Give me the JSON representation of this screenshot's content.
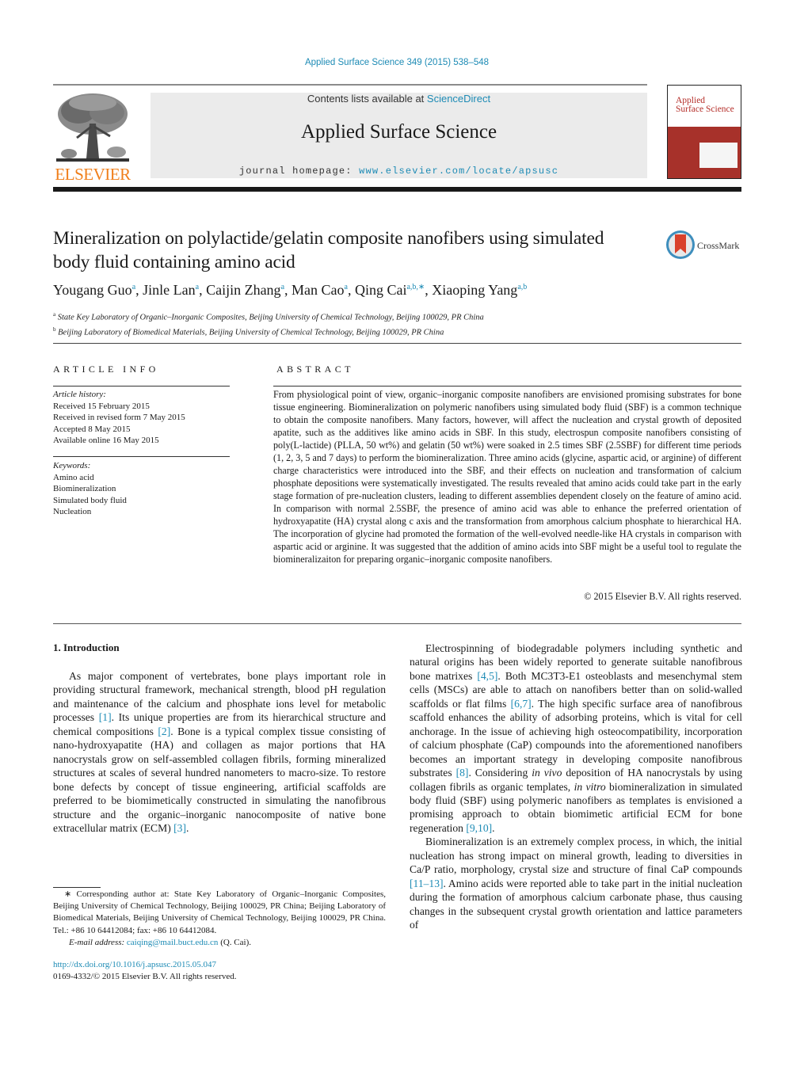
{
  "running_head": "Applied Surface Science 349 (2015) 538–548",
  "masthead": {
    "publisher_name": "ELSEVIER",
    "contents_prefix": "Contents lists available at ",
    "contents_link": "ScienceDirect",
    "journal_title": "Applied Surface Science",
    "homepage_prefix": "journal homepage: ",
    "homepage_link": "www.elsevier.com/locate/apsusc",
    "cover_title_line1": "Applied",
    "cover_title_line2": "Surface Science",
    "colors": {
      "link": "#1d8bb5",
      "elsevier_orange": "#f07f1b",
      "cover_red": "#a7312a",
      "box_gray": "#ebebeb"
    }
  },
  "article": {
    "title": "Mineralization on polylactide/gelatin composite nanofibers using simulated body fluid containing amino acid",
    "crossmark_label": "CrossMark",
    "authors": [
      {
        "name": "Yougang Guo",
        "aff": "a"
      },
      {
        "name": "Jinle Lan",
        "aff": "a"
      },
      {
        "name": "Caijin Zhang",
        "aff": "a"
      },
      {
        "name": "Man Cao",
        "aff": "a"
      },
      {
        "name": "Qing Cai",
        "aff": "a,b,∗"
      },
      {
        "name": "Xiaoping Yang",
        "aff": "a,b"
      }
    ],
    "affiliations": [
      {
        "key": "a",
        "text": "State Key Laboratory of Organic–Inorganic Composites, Beijing University of Chemical Technology, Beijing 100029, PR China"
      },
      {
        "key": "b",
        "text": "Beijing Laboratory of Biomedical Materials, Beijing University of Chemical Technology, Beijing 100029, PR China"
      }
    ]
  },
  "article_info": {
    "heading": "ARTICLE INFO",
    "history_label": "Article history:",
    "history": [
      "Received 15 February 2015",
      "Received in revised form 7 May 2015",
      "Accepted 8 May 2015",
      "Available online 16 May 2015"
    ],
    "keywords_label": "Keywords:",
    "keywords": [
      "Amino acid",
      "Biomineralization",
      "Simulated body fluid",
      "Nucleation"
    ]
  },
  "abstract": {
    "heading": "ABSTRACT",
    "text": "From physiological point of view, organic–inorganic composite nanofibers are envisioned promising substrates for bone tissue engineering. Biomineralization on polymeric nanofibers using simulated body fluid (SBF) is a common technique to obtain the composite nanofibers. Many factors, however, will affect the nucleation and crystal growth of deposited apatite, such as the additives like amino acids in SBF. In this study, electrospun composite nanofibers consisting of poly(L-lactide) (PLLA, 50 wt%) and gelatin (50 wt%) were soaked in 2.5 times SBF (2.5SBF) for different time periods (1, 2, 3, 5 and 7 days) to perform the biomineralization. Three amino acids (glycine, aspartic acid, or arginine) of different charge characteristics were introduced into the SBF, and their effects on nucleation and transformation of calcium phosphate depositions were systematically investigated. The results revealed that amino acids could take part in the early stage formation of pre-nucleation clusters, leading to different assemblies dependent closely on the feature of amino acid. In comparison with normal 2.5SBF, the presence of amino acid was able to enhance the preferred orientation of hydroxyapatite (HA) crystal along c axis and the transformation from amorphous calcium phosphate to hierarchical HA. The incorporation of glycine had promoted the formation of the well-evolved needle-like HA crystals in comparison with aspartic acid or arginine. It was suggested that the addition of amino acids into SBF might be a useful tool to regulate the biomineralizaiton for preparing organic–inorganic composite nanofibers.",
    "copyright": "© 2015 Elsevier B.V. All rights reserved."
  },
  "body": {
    "section_heading": "1.  Introduction",
    "left_paragraphs": [
      [
        {
          "t": "As major component of vertebrates, bone plays important role in providing structural framework, mechanical strength, blood pH regulation and maintenance of the calcium and phosphate ions level for metabolic processes "
        },
        {
          "ref": "[1]"
        },
        {
          "t": ". Its unique properties are from its hierarchical structure and chemical compositions "
        },
        {
          "ref": "[2]"
        },
        {
          "t": ". Bone is a typical complex tissue consisting of nano-hydroxyapatite (HA) and collagen as major portions that HA nanocrystals grow on self-assembled collagen fibrils, forming mineralized structures at scales of several hundred nanometers to macro-size. To restore bone defects by concept of tissue engineering, artificial scaffolds are preferred to be biomimetically constructed in simulating the nanofibrous structure and the organic–inorganic nanocomposite of native bone extracellular matrix (ECM) "
        },
        {
          "ref": "[3]"
        },
        {
          "t": "."
        }
      ]
    ],
    "right_paragraphs": [
      [
        {
          "t": "Electrospinning of biodegradable polymers including synthetic and natural origins has been widely reported to generate suitable nanofibrous bone matrixes "
        },
        {
          "ref": "[4,5]"
        },
        {
          "t": ". Both MC3T3-E1 osteoblasts and mesenchymal stem cells (MSCs) are able to attach on nanofibers better than on solid-walled scaffolds or flat films "
        },
        {
          "ref": "[6,7]"
        },
        {
          "t": ". The high specific surface area of nanofibrous scaffold enhances the ability of adsorbing proteins, which is vital for cell anchorage. In the issue of achieving high osteocompatibility, incorporation of calcium phosphate (CaP) compounds into the aforementioned nanofibers becomes an important strategy in developing composite nanofibrous substrates "
        },
        {
          "ref": "[8]"
        },
        {
          "t": ". Considering "
        },
        {
          "i": "in vivo"
        },
        {
          "t": " deposition of HA nanocrystals by using collagen fibrils as organic templates, "
        },
        {
          "i": "in vitro"
        },
        {
          "t": " biomineralization in simulated body fluid (SBF) using polymeric nanofibers as templates is envisioned a promising approach to obtain biomimetic artificial ECM for bone regeneration "
        },
        {
          "ref": "[9,10]"
        },
        {
          "t": "."
        }
      ],
      [
        {
          "t": "Biomineralization is an extremely complex process, in which, the initial nucleation has strong impact on mineral growth, leading to diversities in Ca/P ratio, morphology, crystal size and structure of final CaP compounds "
        },
        {
          "ref": "[11–13]"
        },
        {
          "t": ". Amino acids were reported able to take part in the initial nucleation during the formation of amorphous calcium carbonate phase, thus causing changes in the subsequent crystal growth orientation and lattice parameters of"
        }
      ]
    ]
  },
  "footnotes": {
    "corresponding": "∗ Corresponding author at: State Key Laboratory of Organic–Inorganic Composites, Beijing University of Chemical Technology, Beijing 100029, PR China; Beijing Laboratory of Biomedical Materials, Beijing University of Chemical Technology, Beijing 100029, PR China. Tel.: +86 10 64412084; fax: +86 10 64412084.",
    "email_label": "E-mail address: ",
    "email": "caiqing@mail.buct.edu.cn",
    "email_suffix": " (Q. Cai).",
    "doi": "http://dx.doi.org/10.1016/j.apsusc.2015.05.047",
    "issn": "0169-4332/© 2015 Elsevier B.V. All rights reserved."
  }
}
